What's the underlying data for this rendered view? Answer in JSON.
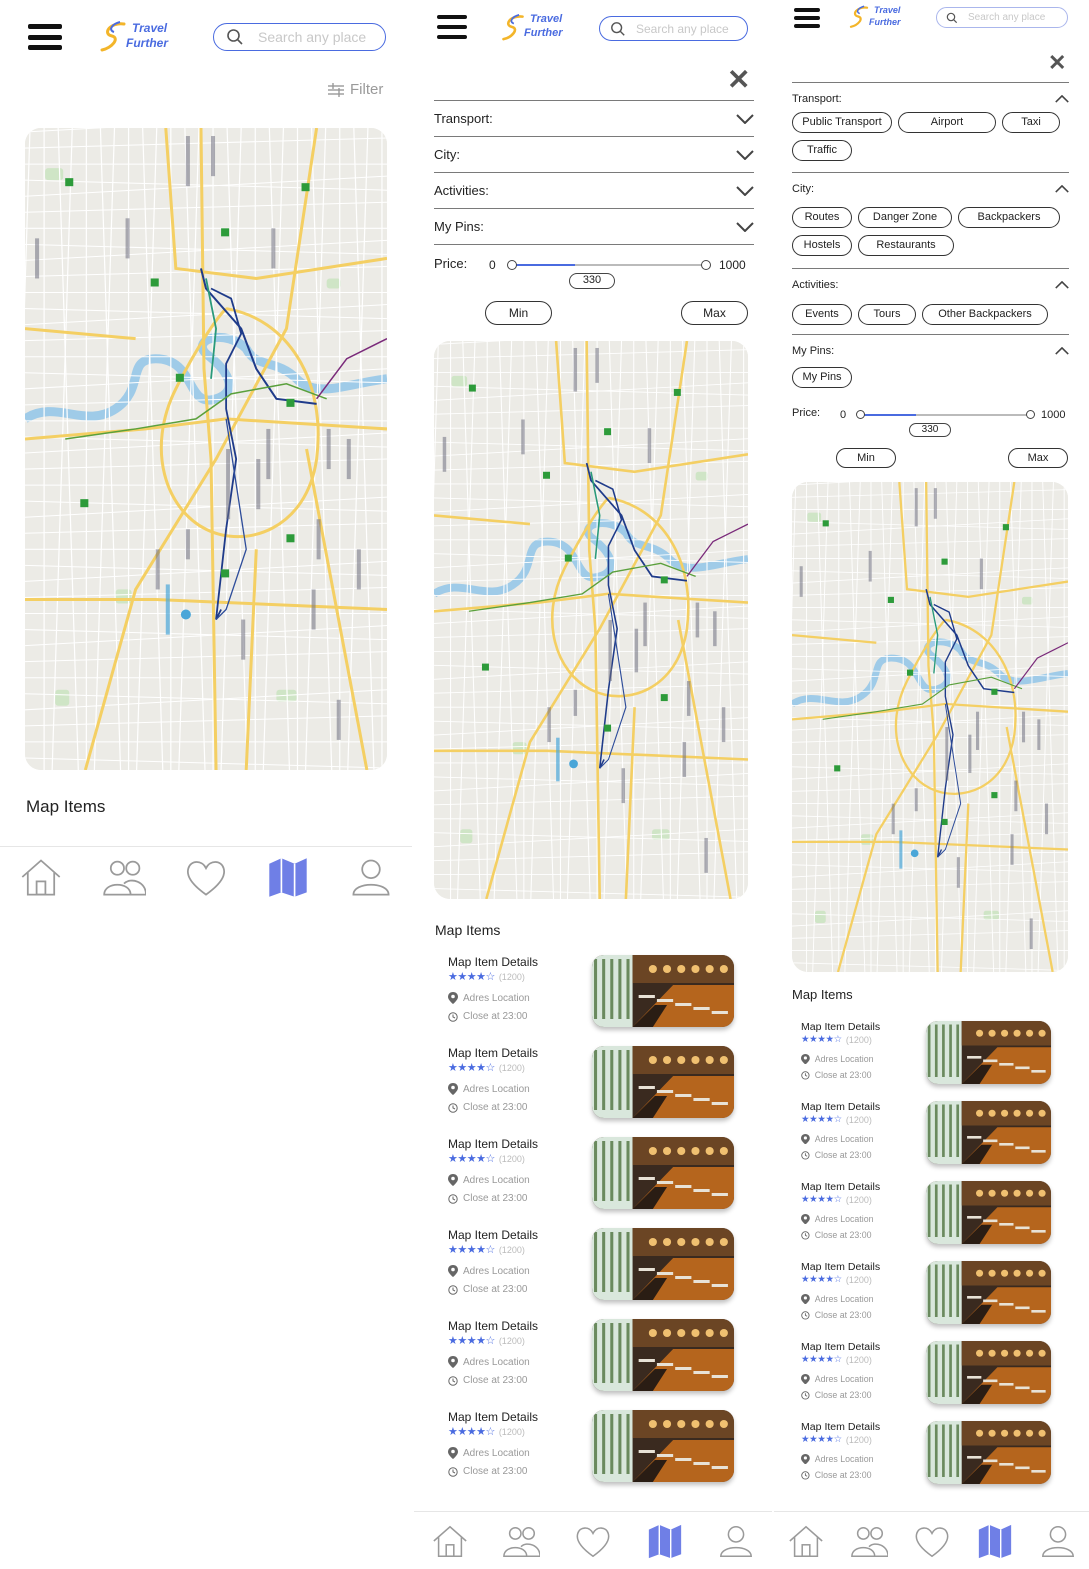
{
  "app": {
    "logo_line1": "Travel",
    "logo_line2": "Further",
    "search_placeholder": "Search any place",
    "brand_color": "#4a6be0"
  },
  "screen1": {
    "filter_label": "Filter",
    "map_items_title": "Map Items"
  },
  "filters": {
    "transport_label": "Transport:",
    "city_label": "City:",
    "activities_label": "Activities:",
    "my_pins_label": "My Pins:",
    "price_label": "Price:",
    "price_min": "0",
    "price_max": "1000",
    "price_value": "330",
    "price_fraction": 0.33,
    "min_button": "Min",
    "max_button": "Max",
    "transport_options": [
      "Public Transport",
      "Airport",
      "Taxi",
      "Traffic"
    ],
    "city_options": [
      "Routes",
      "Danger Zone",
      "Backpackers",
      "Hostels",
      "Restaurants"
    ],
    "activities_options": [
      "Events",
      "Tours",
      "Other Backpackers"
    ],
    "my_pins_options": [
      "My Pins"
    ]
  },
  "map_items_title": "Map Items",
  "items": [
    {
      "title": "Map Item Details",
      "rating": "★★★★☆",
      "reviews": "(1200)",
      "location": "Adres Location",
      "hours": "Close at 23:00"
    },
    {
      "title": "Map Item Details",
      "rating": "★★★★☆",
      "reviews": "(1200)",
      "location": "Adres Location",
      "hours": "Close at 23:00"
    },
    {
      "title": "Map Item Details",
      "rating": "★★★★☆",
      "reviews": "(1200)",
      "location": "Adres Location",
      "hours": "Close at 23:00"
    },
    {
      "title": "Map Item Details",
      "rating": "★★★★☆",
      "reviews": "(1200)",
      "location": "Adres Location",
      "hours": "Close at 23:00"
    },
    {
      "title": "Map Item Details",
      "rating": "★★★★☆",
      "reviews": "(1200)",
      "location": "Adres Location",
      "hours": "Close at 23:00"
    },
    {
      "title": "Map Item Details",
      "rating": "★★★★☆",
      "reviews": "(1200)",
      "location": "Adres Location",
      "hours": "Close at 23:00"
    }
  ],
  "nav": {
    "items": [
      "home-icon",
      "people-icon",
      "heart-icon",
      "map-icon",
      "profile-icon"
    ],
    "active": "map-icon",
    "active_color": "#6f7fe6",
    "inactive_color": "#9a9a9a"
  }
}
